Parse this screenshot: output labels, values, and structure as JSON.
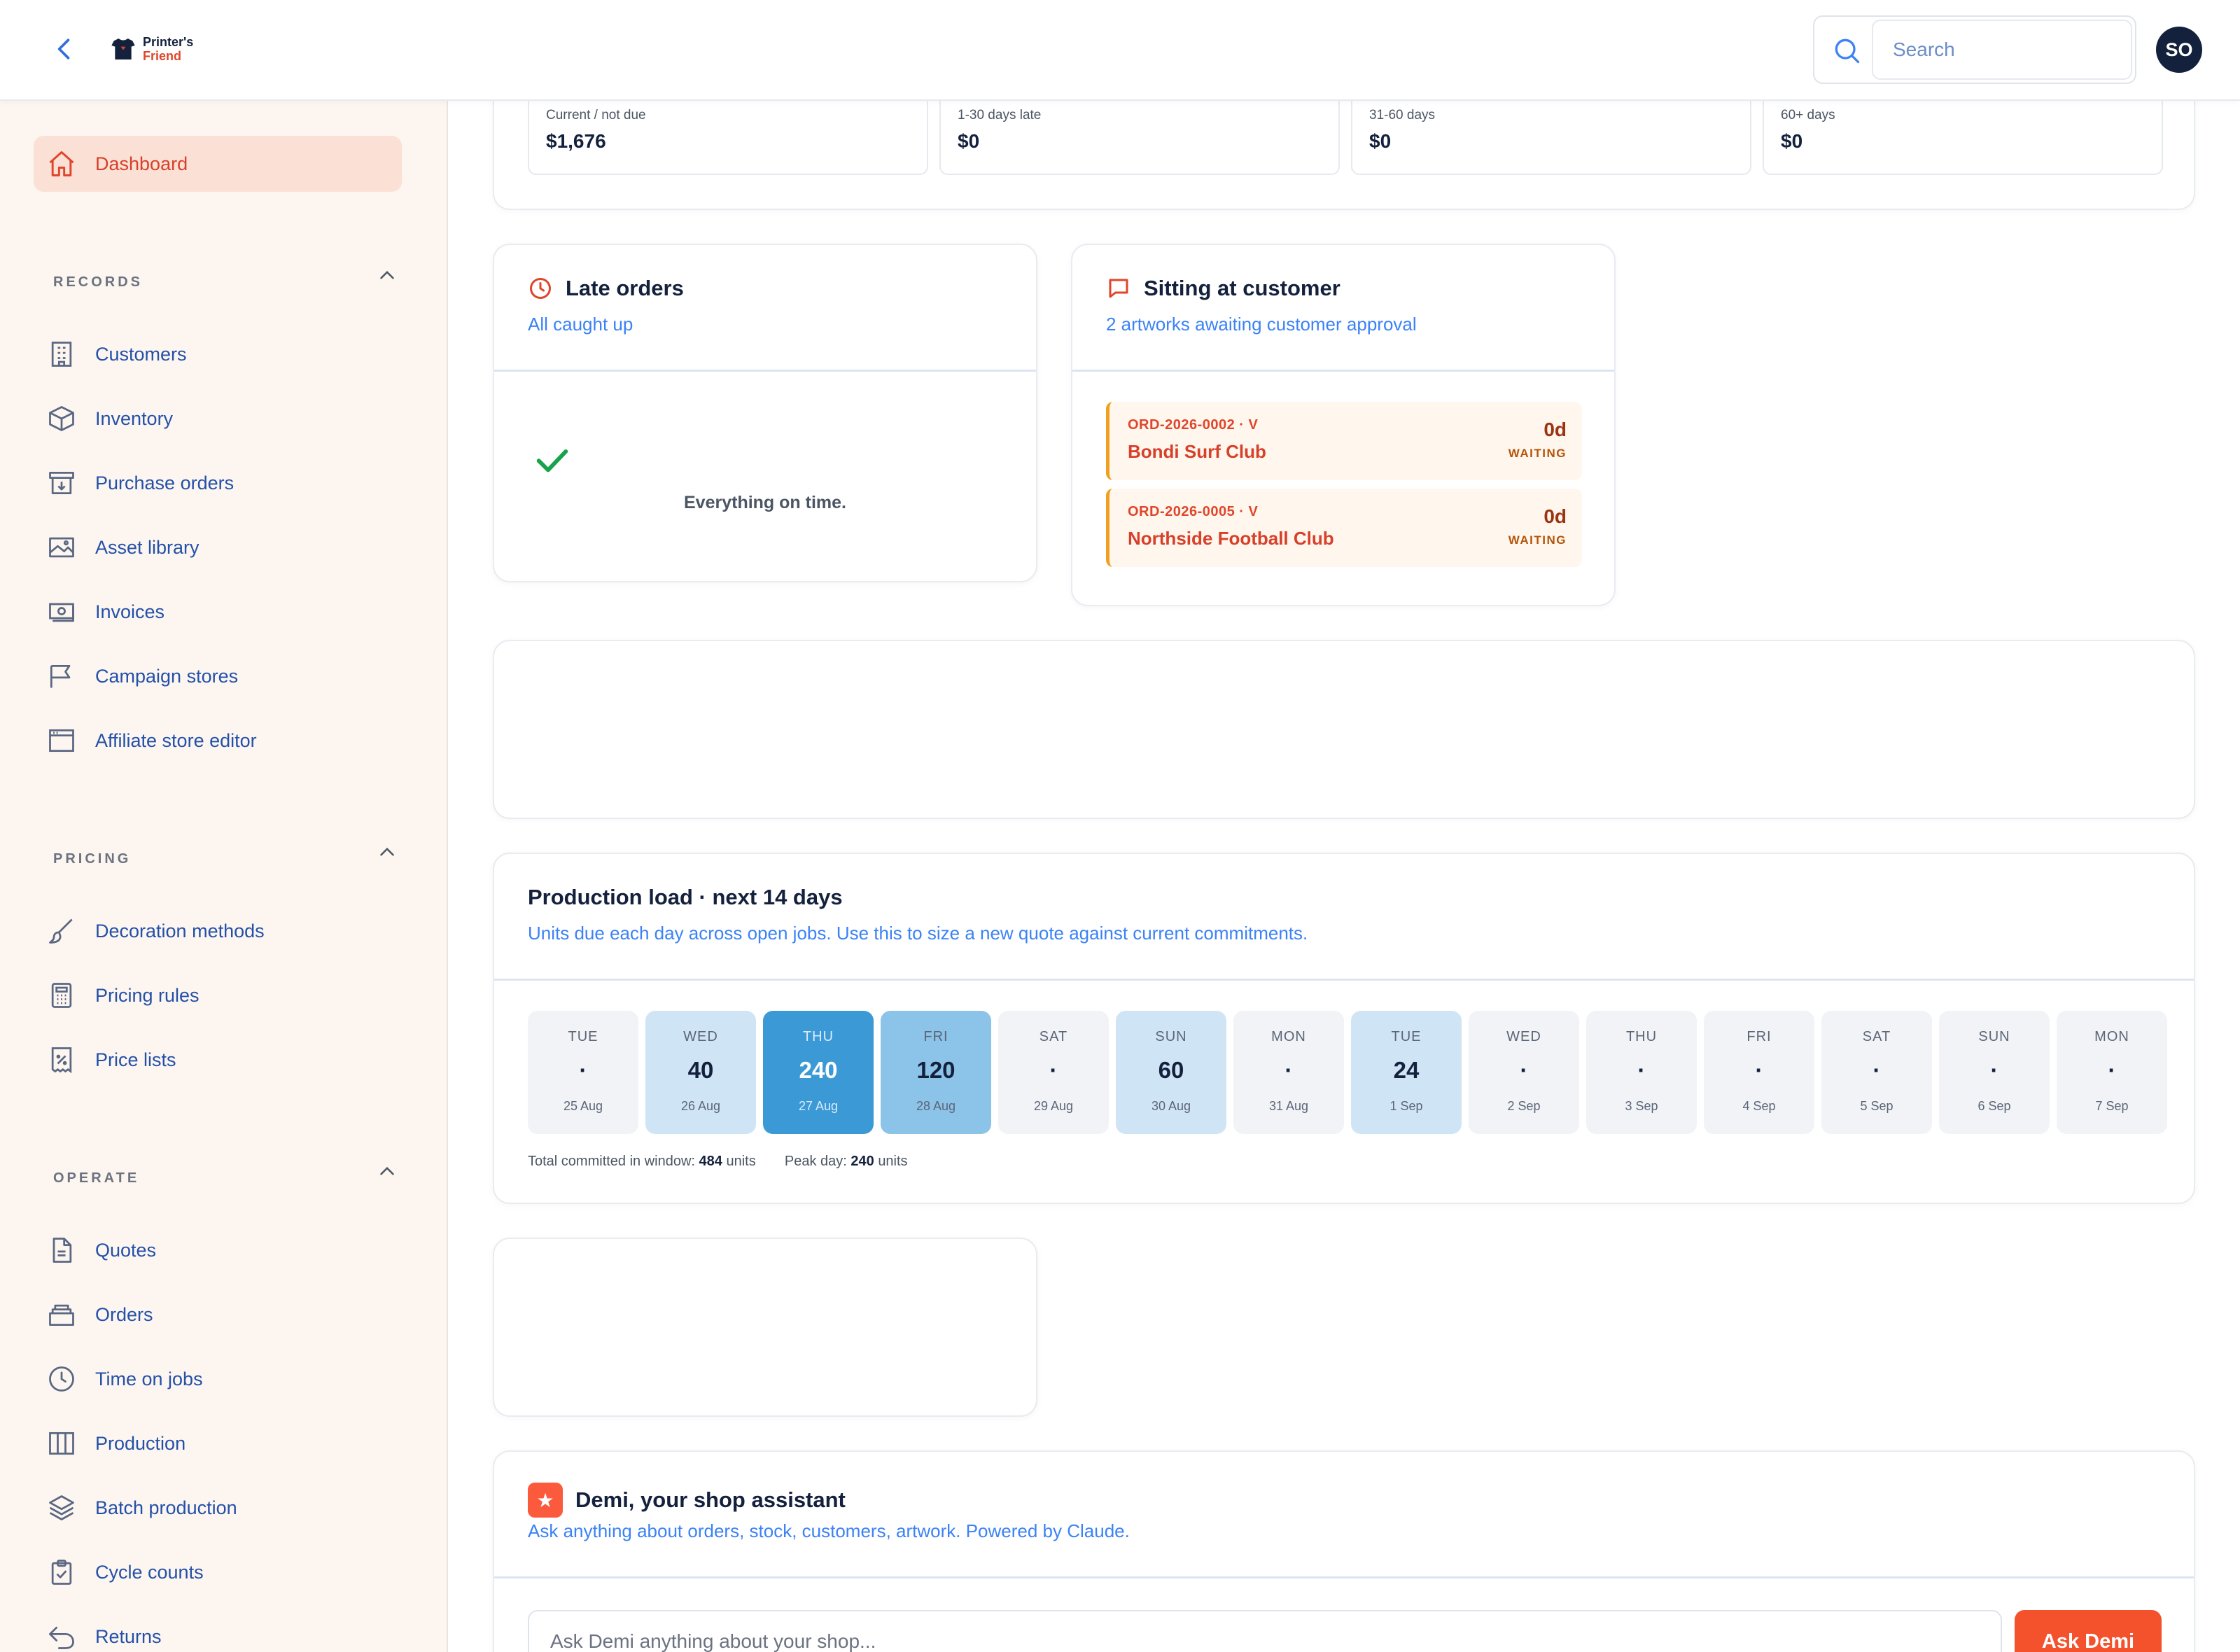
{
  "header": {
    "brand_line1": "Printer's",
    "brand_line2": "Friend",
    "search_placeholder": "Search",
    "avatar_initials": "SO"
  },
  "sidebar": {
    "dashboard": "Dashboard",
    "sections": [
      {
        "title": "RECORDS",
        "items": [
          "Customers",
          "Inventory",
          "Purchase orders",
          "Asset library",
          "Invoices",
          "Campaign stores",
          "Affiliate store editor"
        ]
      },
      {
        "title": "PRICING",
        "items": [
          "Decoration methods",
          "Pricing rules",
          "Price lists"
        ]
      },
      {
        "title": "OPERATE",
        "items": [
          "Quotes",
          "Orders",
          "Time on jobs",
          "Production",
          "Batch production",
          "Cycle counts",
          "Returns"
        ]
      }
    ]
  },
  "aging": [
    {
      "label": "Current / not due",
      "value": "$1,676"
    },
    {
      "label": "1-30 days late",
      "value": "$0"
    },
    {
      "label": "31-60 days",
      "value": "$0"
    },
    {
      "label": "60+ days",
      "value": "$0"
    }
  ],
  "late_orders": {
    "title": "Late orders",
    "subtitle": "All caught up",
    "message": "Everything on time."
  },
  "sitting": {
    "title": "Sitting at customer",
    "subtitle": "2 artworks awaiting customer approval",
    "orders": [
      {
        "id": "ORD-2026-0002 · V",
        "customer": "Bondi Surf Club",
        "days": "0d",
        "status": "WAITING"
      },
      {
        "id": "ORD-2026-0005 · V",
        "customer": "Northside Football Club",
        "days": "0d",
        "status": "WAITING"
      }
    ]
  },
  "production": {
    "title": "Production load · next 14 days",
    "subtitle": "Units due each day across open jobs. Use this to size a new quote against current commitments.",
    "days": [
      {
        "wd": "TUE",
        "val": "·",
        "date": "25 Aug",
        "units": 0
      },
      {
        "wd": "WED",
        "val": "40",
        "date": "26 Aug",
        "units": 40
      },
      {
        "wd": "THU",
        "val": "240",
        "date": "27 Aug",
        "units": 240
      },
      {
        "wd": "FRI",
        "val": "120",
        "date": "28 Aug",
        "units": 120
      },
      {
        "wd": "SAT",
        "val": "·",
        "date": "29 Aug",
        "units": 0
      },
      {
        "wd": "SUN",
        "val": "60",
        "date": "30 Aug",
        "units": 60
      },
      {
        "wd": "MON",
        "val": "·",
        "date": "31 Aug",
        "units": 0
      },
      {
        "wd": "TUE",
        "val": "24",
        "date": "1 Sep",
        "units": 24
      },
      {
        "wd": "WED",
        "val": "·",
        "date": "2 Sep",
        "units": 0
      },
      {
        "wd": "THU",
        "val": "·",
        "date": "3 Sep",
        "units": 0
      },
      {
        "wd": "FRI",
        "val": "·",
        "date": "4 Sep",
        "units": 0
      },
      {
        "wd": "SAT",
        "val": "·",
        "date": "5 Sep",
        "units": 0
      },
      {
        "wd": "SUN",
        "val": "·",
        "date": "6 Sep",
        "units": 0
      },
      {
        "wd": "MON",
        "val": "·",
        "date": "7 Sep",
        "units": 0
      }
    ],
    "total_label": "Total committed in window:",
    "total_value": "484",
    "peak_label": "Peak day:",
    "peak_value": "240",
    "units_word": "units"
  },
  "assistant": {
    "title": "Demi, your shop assistant",
    "subtitle": "Ask anything about orders, stock, customers, artwork. Powered by Claude.",
    "placeholder": "Ask Demi anything about your shop...",
    "button": "Ask Demi"
  },
  "colors": {
    "accent": "#e0452b",
    "link": "#2350a8",
    "heat_dark": "#3b9ad6",
    "heat_mid": "#8cc3e8",
    "heat_light": "#cfe5f6",
    "heat_none": "#f1f3f6"
  }
}
